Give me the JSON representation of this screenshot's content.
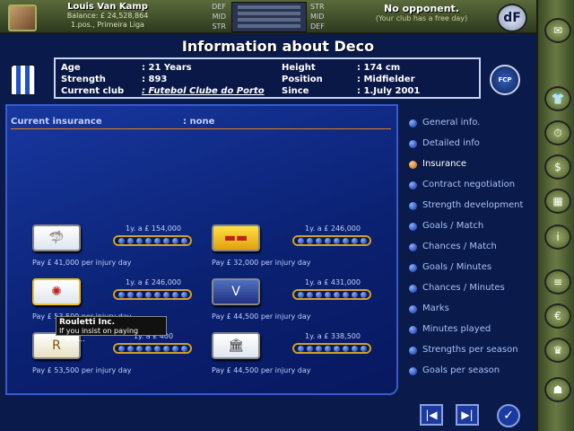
{
  "topbar": {
    "manager_name": "Louis Van Kamp",
    "balance": "Balance: £ 24,528,864",
    "league_pos": "1.pos., Primeira Liga",
    "pos_left": [
      "DEF",
      "MID",
      "STR"
    ],
    "pos_right": [
      "STR",
      "MID",
      "DEF"
    ],
    "opponent_title": "No opponent.",
    "opponent_sub": "(Your club has a free day)",
    "logo_text": "dF"
  },
  "header": {
    "title": "Information about  Deco",
    "badge": "FCP"
  },
  "info": {
    "age_label": "Age",
    "age_value": ": 21 Years",
    "strength_label": "Strength",
    "strength_value": ": 893",
    "club_label": "Current club",
    "club_value": ": Futebol Clube do Porto",
    "height_label": "Height",
    "height_value": ": 174 cm",
    "position_label": "Position",
    "position_value": ": Midfielder",
    "since_label": "Since",
    "since_value": ": 1.July 2001"
  },
  "insurance": {
    "label": "Current insurance",
    "value": ": none"
  },
  "policies": [
    {
      "icon": "shark-icon",
      "pay": "Pay £ 41,000 per injury day",
      "cost": "1y. a £ 154,000"
    },
    {
      "icon": "bricks-icon",
      "pay": "Pay £ 32,000 per injury day",
      "cost": "1y. a £ 246,000"
    },
    {
      "icon": "roulette-icon",
      "pay": "Pay £ 53,500 per injury day",
      "cost": "1y. a £ 246,000"
    },
    {
      "icon": "wings-icon",
      "pay": "Pay £ 44,500 per injury day",
      "cost": "1y. a £ 431,000"
    },
    {
      "icon": "royal-icon",
      "pay": "Pay £ 53,500 per injury day",
      "cost": "1y. a £ 400"
    },
    {
      "icon": "temple-icon",
      "pay": "Pay £ 44,500 per injury day",
      "cost": "1y. a £ 338,500"
    }
  ],
  "tooltip": {
    "title": "Rouletti Inc.",
    "text": "If you insist on paying them..."
  },
  "menu": [
    {
      "label": "General info."
    },
    {
      "label": "Detailed info"
    },
    {
      "label": "Insurance",
      "active": true
    },
    {
      "label": "Contract negotiation"
    },
    {
      "label": "Strength development"
    },
    {
      "label": "Goals / Match"
    },
    {
      "label": "Chances / Match"
    },
    {
      "label": "Goals / Minutes"
    },
    {
      "label": "Chances / Minutes"
    },
    {
      "label": "Marks"
    },
    {
      "label": "Minutes played"
    },
    {
      "label": "Strengths per season"
    },
    {
      "label": "Goals per season"
    }
  ],
  "buttons": {
    "prev": "|◀",
    "next": "▶|",
    "ok": "✓"
  },
  "sidebar_icons": [
    "mail-icon",
    "shirt-icon",
    "stopwatch-icon",
    "money-icon",
    "stadium-icon",
    "info-icon",
    "notes-icon",
    "euro-icon",
    "trophy-icon",
    "player-icon"
  ]
}
